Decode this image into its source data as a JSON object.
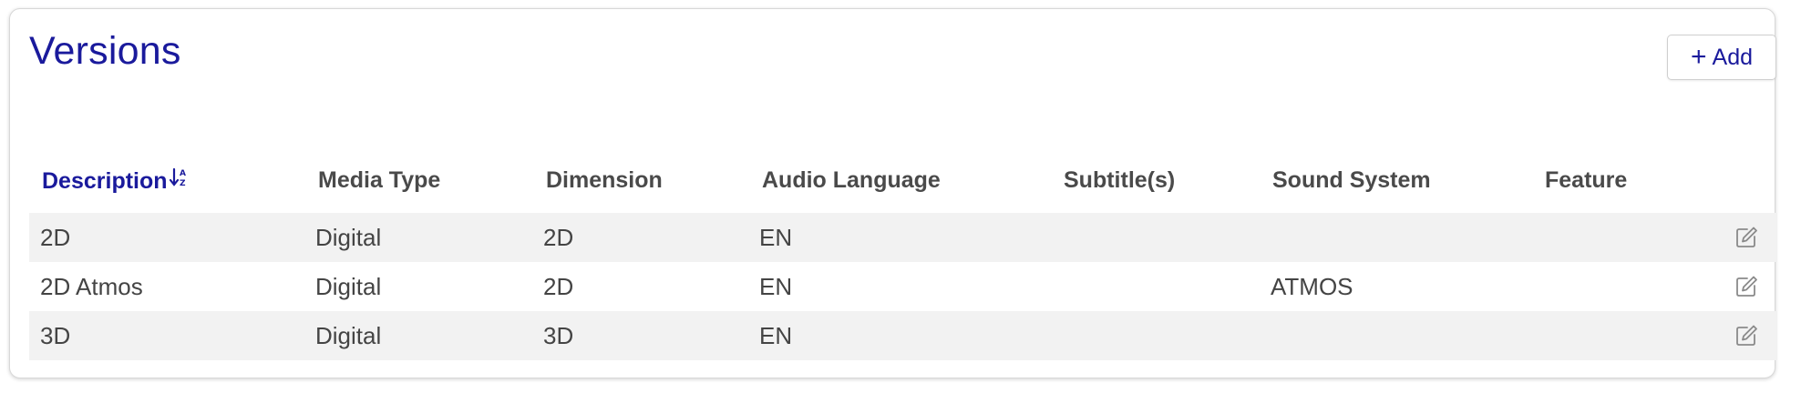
{
  "panel": {
    "title": "Versions",
    "add_button": {
      "icon": "plus-icon",
      "label": "Add"
    }
  },
  "table": {
    "columns": [
      {
        "label": "Description",
        "sorted": true,
        "sort_icon": "↓a/z"
      },
      {
        "label": "Media Type"
      },
      {
        "label": "Dimension"
      },
      {
        "label": "Audio Language"
      },
      {
        "label": "Subtitle(s)"
      },
      {
        "label": "Sound System"
      },
      {
        "label": "Feature"
      }
    ],
    "rows": [
      {
        "description": "2D",
        "media_type": "Digital",
        "dimension": "2D",
        "audio_language": "EN",
        "subtitles": "",
        "sound_system": "",
        "feature": ""
      },
      {
        "description": "2D Atmos",
        "media_type": "Digital",
        "dimension": "2D",
        "audio_language": "EN",
        "subtitles": "",
        "sound_system": "ATMOS",
        "feature": ""
      },
      {
        "description": "3D",
        "media_type": "Digital",
        "dimension": "3D",
        "audio_language": "EN",
        "subtitles": "",
        "sound_system": "",
        "feature": ""
      }
    ],
    "row_action_icon": "edit-icon"
  },
  "colors": {
    "accent": "#1a1a9c",
    "header_text": "#4a4a4a",
    "body_text": "#444444",
    "alt_row": "#f2f2f2"
  }
}
